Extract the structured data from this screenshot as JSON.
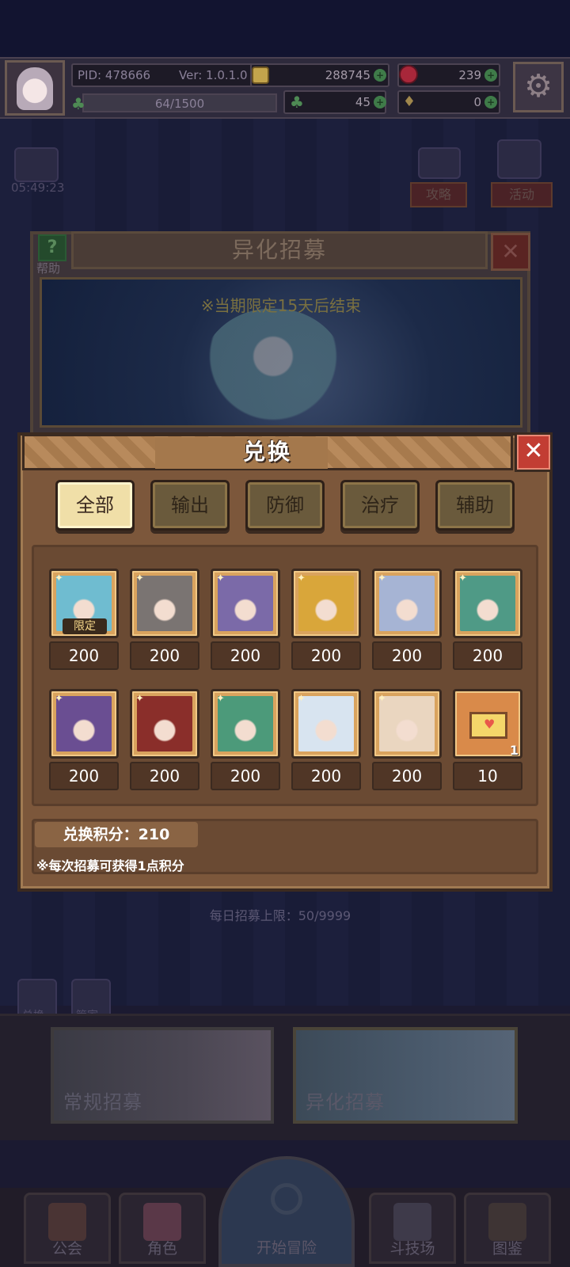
{
  "header": {
    "pid": "PID: 478666",
    "version": "Ver: 1.0.1.0",
    "gold": "288745",
    "gems": "239",
    "stamina": "64/1500",
    "clover": "45",
    "bag": "0"
  },
  "side": {
    "timer": "05:49:23",
    "guide_label": "攻略",
    "event_label": "活动"
  },
  "recruit_panel": {
    "title": "异化招募",
    "help_label": "帮助",
    "notice": "※当期限定15天后结束",
    "daily_limit": "每日招募上限：50/9999",
    "side_label_1": "兑换",
    "side_label_2": "管家"
  },
  "exchange": {
    "title": "兑换",
    "tabs": [
      "全部",
      "输出",
      "防御",
      "治疗",
      "辅助"
    ],
    "active_tab": 0,
    "items": [
      {
        "price": "200",
        "badge": "限定",
        "color": "#6fbcd0"
      },
      {
        "price": "200",
        "color": "#7a7472"
      },
      {
        "price": "200",
        "color": "#7b6aa8"
      },
      {
        "price": "200",
        "color": "#d9a63a"
      },
      {
        "price": "200",
        "color": "#a6b4d4"
      },
      {
        "price": "200",
        "color": "#4f9a86"
      },
      {
        "price": "200",
        "color": "#6a4e92"
      },
      {
        "price": "200",
        "color": "#8a2e2a"
      },
      {
        "price": "200",
        "color": "#4c9a7a"
      },
      {
        "price": "200",
        "color": "#d8e4f0"
      },
      {
        "price": "200",
        "color": "#ead6c0"
      },
      {
        "price": "10",
        "count": "1",
        "icon": "envelope-icon"
      }
    ],
    "points_label": "兑换积分：210",
    "note": "※每次招募可获得1点积分"
  },
  "recruit_selector": {
    "normal": "常规招募",
    "special": "异化招募"
  },
  "nav": {
    "guild": "公会",
    "character": "角色",
    "adventure": "开始冒险",
    "arena": "斗技场",
    "codex": "图鉴"
  }
}
